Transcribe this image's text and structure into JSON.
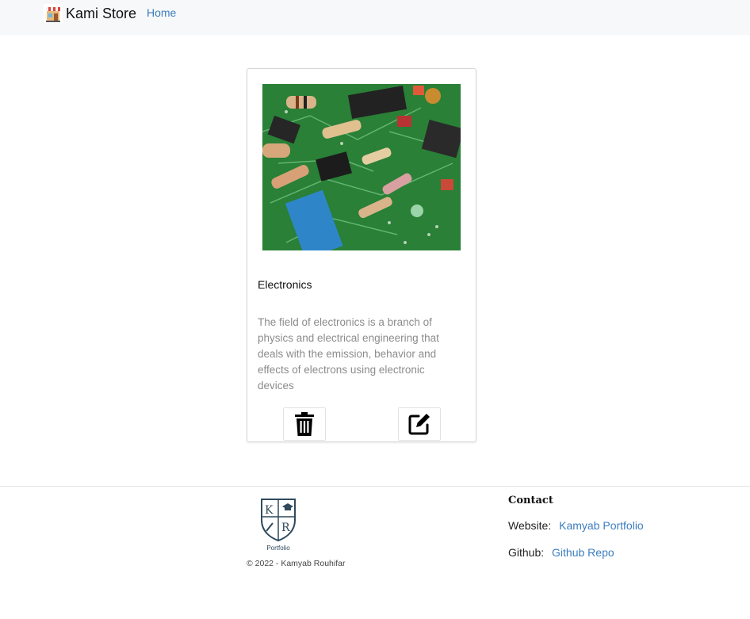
{
  "navbar": {
    "brand_name": "Kami Store",
    "brand_icon": "store-icon",
    "home_label": "Home"
  },
  "card": {
    "image_icon": "circuit-board-image",
    "title": "Electronics",
    "description": "The field of electronics is a branch of physics and electrical engineering that deals with the emission, behavior and effects of electrons using electronic devices",
    "delete_icon": "trash-icon",
    "edit_icon": "edit-icon"
  },
  "footer": {
    "logo_text": "Portfolio",
    "logo_letters": [
      "K",
      "R"
    ],
    "copyright": "© 2022 - Kamyab Rouhifar",
    "contact_heading": "Contact",
    "website_label": "Website:",
    "website_link": "Kamyab Portfolio",
    "github_label": "Github:",
    "github_link": "Github Repo"
  },
  "colors": {
    "link": "#3b7dbf",
    "navbar_bg": "#f7f8f9",
    "muted_text": "#8c8c8c",
    "pcb_green": "#2f8a3c"
  }
}
